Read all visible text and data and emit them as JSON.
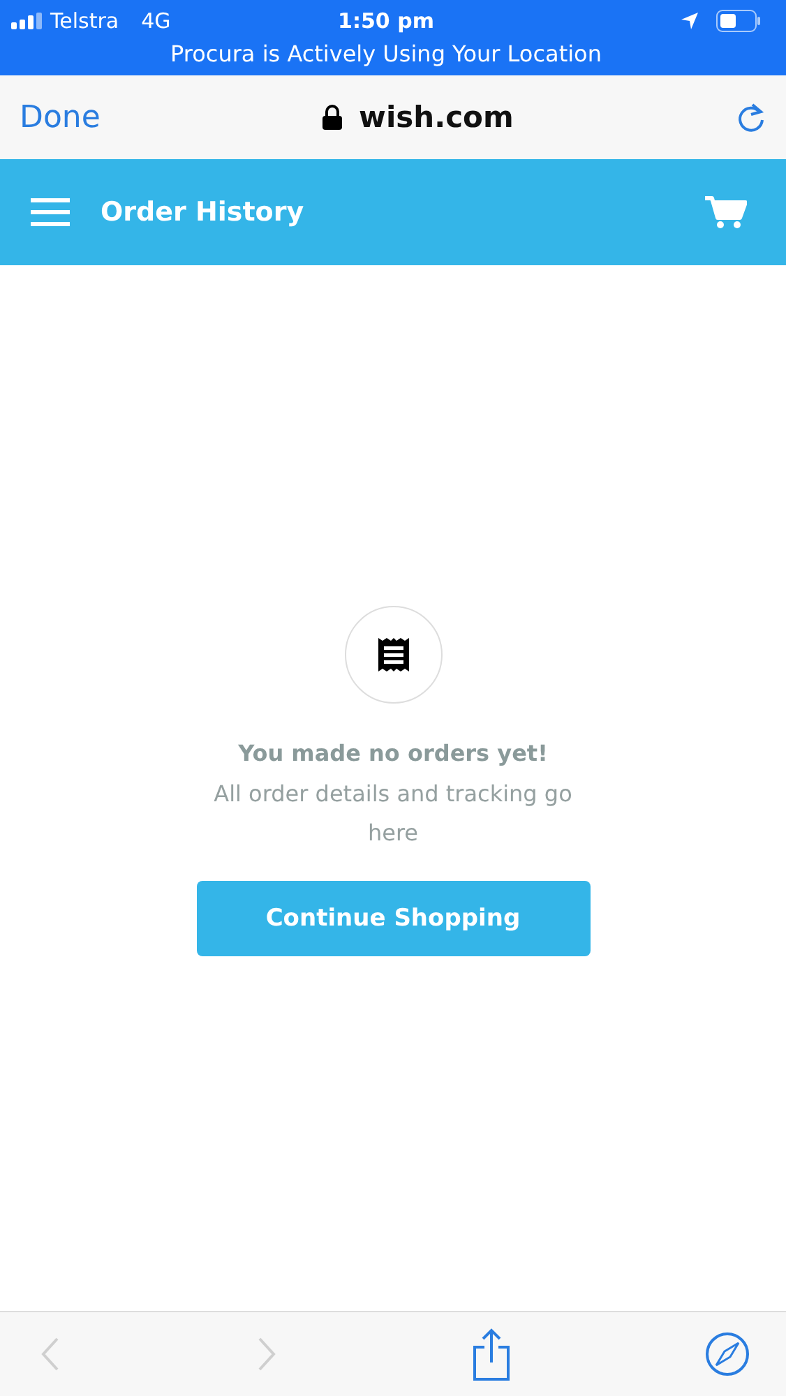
{
  "status_bar": {
    "carrier": "Telstra",
    "network": "4G",
    "time": "1:50 pm",
    "location_banner": "Procura is Actively Using Your Location"
  },
  "browser_bar": {
    "done": "Done",
    "url": "wish.com"
  },
  "header": {
    "title": "Order History"
  },
  "empty_state": {
    "title": "You made no orders yet!",
    "message": "All order details and tracking go here",
    "button": "Continue Shopping"
  },
  "toolbar": {
    "back_disabled": true,
    "forward_disabled": true
  }
}
